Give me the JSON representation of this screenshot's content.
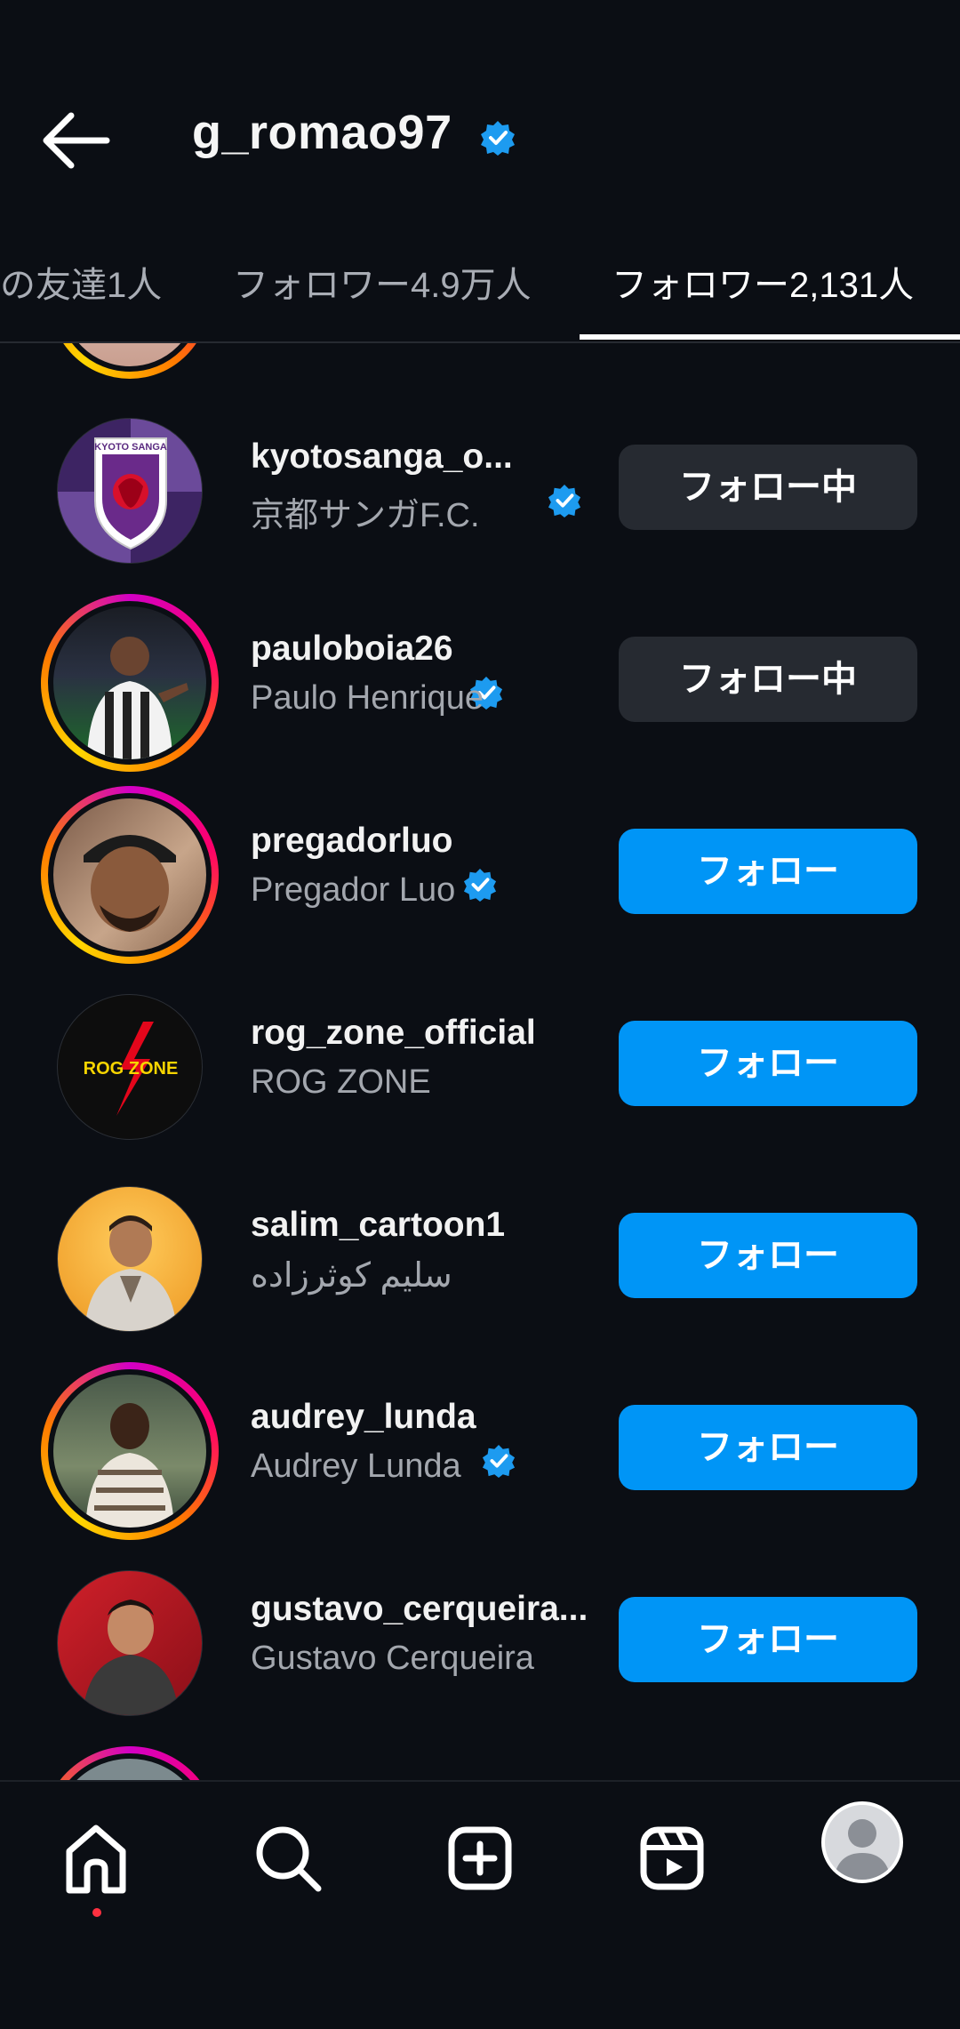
{
  "header": {
    "title": "g_romao97"
  },
  "tabs": [
    {
      "label": "の友達1人"
    },
    {
      "label": "フォロワー4.9万人"
    },
    {
      "label": "フォロワー2,131人"
    }
  ],
  "rows": [
    {
      "username": "kyotosanga_o...",
      "full_name": "京都サンガF.C.",
      "button": "フォロー中"
    },
    {
      "username": "pauloboia26",
      "full_name": "Paulo Henrique",
      "button": "フォロー中"
    },
    {
      "username": "pregadorluo",
      "full_name": "Pregador Luo",
      "button": "フォロー"
    },
    {
      "username": "rog_zone_official",
      "full_name": "ROG ZONE",
      "button": "フォロー",
      "logo_text": "ROG ZONE"
    },
    {
      "username": "salim_cartoon1",
      "full_name": "سلیم کوثرزاده",
      "button": "フォロー"
    },
    {
      "username": "audrey_lunda",
      "full_name": "Audrey Lunda",
      "button": "フォロー"
    },
    {
      "username": "gustavo_cerqueira...",
      "full_name": "Gustavo Cerqueira",
      "button": "フォロー"
    }
  ],
  "logo_text": {
    "kyoto": "KYOTO SANGA"
  },
  "colors": {
    "accent": "#0095f6",
    "following_bg": "#262a31",
    "background": "#0b0e14",
    "verified": "#1d9bf0",
    "notification_dot": "#ff3040"
  },
  "bottom_nav": {
    "items": [
      "home-icon",
      "search-icon",
      "create-icon",
      "reels-icon",
      "profile-avatar"
    ]
  }
}
